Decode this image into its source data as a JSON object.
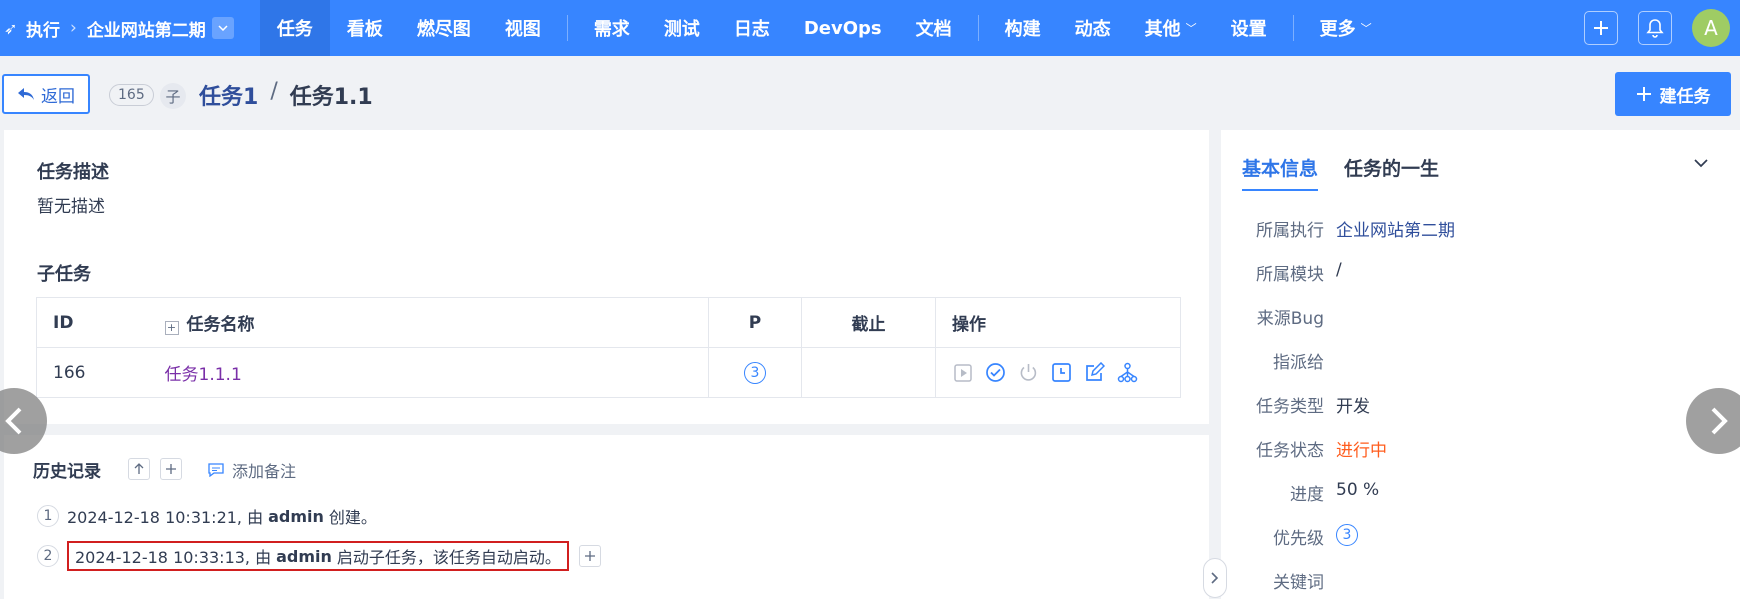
{
  "topnav": {
    "exec_label": "执行",
    "project_name": "企业网站第二期",
    "items": [
      {
        "label": "任务",
        "active": true
      },
      {
        "label": "看板"
      },
      {
        "label": "燃尽图"
      },
      {
        "label": "视图"
      },
      {
        "label": "需求"
      },
      {
        "label": "测试"
      },
      {
        "label": "日志"
      },
      {
        "label": "DevOps"
      },
      {
        "label": "文档"
      },
      {
        "label": "构建"
      },
      {
        "label": "动态"
      },
      {
        "label": "其他"
      },
      {
        "label": "设置"
      },
      {
        "label": "更多"
      }
    ],
    "avatar_letter": "A"
  },
  "titlebar": {
    "back_label": "返回",
    "task_id": "165",
    "child_badge": "子",
    "parent_task": "任务1",
    "separator": "/",
    "current_task": "任务1.1",
    "new_task_label": "建任务"
  },
  "description": {
    "title": "任务描述",
    "text": "暂无描述"
  },
  "subtasks": {
    "title": "子任务",
    "headers": {
      "id": "ID",
      "name": "任务名称",
      "priority": "P",
      "deadline": "截止",
      "actions": "操作"
    },
    "rows": [
      {
        "id": "166",
        "name": "任务1.1.1",
        "priority": "3",
        "deadline": ""
      }
    ]
  },
  "history": {
    "title": "历史记录",
    "add_note_label": "添加备注",
    "entries": [
      {
        "num": "1",
        "time": "2024-12-18 10:31:21, 由",
        "user": "admin",
        "action": "创建。"
      },
      {
        "num": "2",
        "time": "2024-12-18 10:33:13, 由",
        "user": "admin",
        "action": "启动子任务，该任务自动启动。"
      }
    ]
  },
  "side": {
    "tabs": [
      "基本信息",
      "任务的一生"
    ],
    "info": [
      {
        "label": "所属执行",
        "value": "企业网站第二期"
      },
      {
        "label": "所属模块",
        "value": "/"
      },
      {
        "label": "来源Bug",
        "value": ""
      },
      {
        "label": "指派给",
        "value": ""
      },
      {
        "label": "任务类型",
        "value": "开发"
      },
      {
        "label": "任务状态",
        "value": "进行中"
      },
      {
        "label": "进度",
        "value": "50 %"
      },
      {
        "label": "优先级",
        "value": "3"
      },
      {
        "label": "关键词",
        "value": ""
      }
    ]
  },
  "colors": {
    "nav": "#3785ff",
    "accent": "#3785ff",
    "status": "#ff5d1e",
    "highlight": "#d11f1f"
  }
}
